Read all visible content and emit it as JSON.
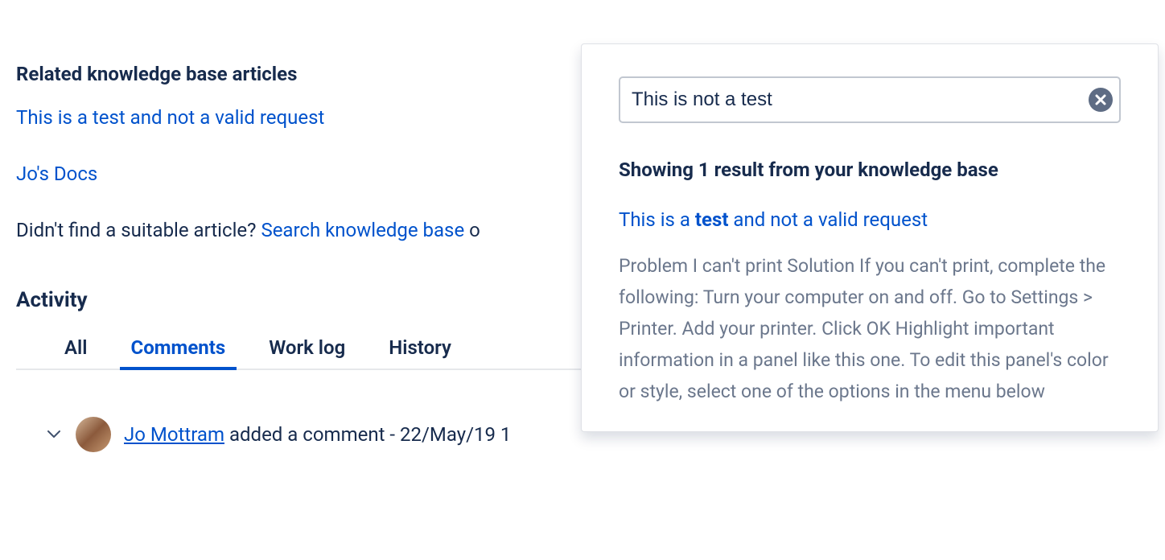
{
  "related": {
    "heading": "Related knowledge base articles",
    "articles": [
      {
        "title": "This is a test and not a valid request"
      },
      {
        "title": "Jo's Docs"
      }
    ],
    "notFound": {
      "prefix": "Didn't find a suitable article? ",
      "link": "Search knowledge base",
      "suffix": " o"
    }
  },
  "activity": {
    "heading": "Activity",
    "tabs": {
      "all": "All",
      "comments": "Comments",
      "worklog": "Work log",
      "history": "History"
    },
    "activeTab": "comments",
    "comment": {
      "author": "Jo Mottram",
      "meta_prefix": " added a comment - ",
      "timestamp": "22/May/19 1"
    }
  },
  "popup": {
    "search": {
      "value": "This is not a test"
    },
    "resultsHeading": "Showing 1 result from your knowledge base",
    "result": {
      "title_pre": "This is a ",
      "title_bold": "test",
      "title_post": " and not a valid request",
      "excerpt": "Problem I can't print Solution If you can't print, complete the following: Turn your computer on and off. Go to Settings > Printer. Add your printer. Click OK Highlight important information in a panel like this one. To edit this panel's color or style, select one of the options in the menu below"
    }
  }
}
